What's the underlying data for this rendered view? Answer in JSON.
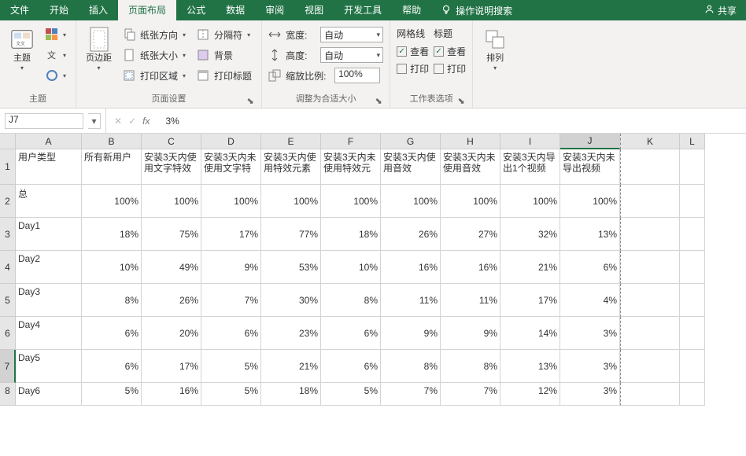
{
  "tabs": {
    "file": "文件",
    "home": "开始",
    "insert": "插入",
    "page_layout": "页面布局",
    "formulas": "公式",
    "data": "数据",
    "review": "审阅",
    "view": "视图",
    "developer": "开发工具",
    "help": "帮助",
    "tell_me": "操作说明搜索",
    "share": "共享"
  },
  "ribbon": {
    "themes": {
      "theme": "主题",
      "label": "主题"
    },
    "margins": "页边距",
    "page_setup": {
      "orientation": "纸张方向",
      "size": "纸张大小",
      "print_area": "打印区域",
      "breaks": "分隔符",
      "background": "背景",
      "print_titles": "打印标题",
      "label": "页面设置"
    },
    "scale": {
      "width": "宽度:",
      "height": "高度:",
      "scale": "缩放比例:",
      "auto": "自动",
      "zoom_value": "100%",
      "label": "调整为合适大小"
    },
    "sheet_options": {
      "gridlines": "网格线",
      "headings": "标题",
      "view": "查看",
      "print": "打印",
      "label": "工作表选项"
    },
    "arrange": {
      "arrange": "排列"
    }
  },
  "name_box": "J7",
  "formula": "3%",
  "columns": [
    "A",
    "B",
    "C",
    "D",
    "E",
    "F",
    "G",
    "H",
    "I",
    "J",
    "K",
    "L"
  ],
  "row_numbers": [
    "1",
    "2",
    "3",
    "4",
    "5",
    "6",
    "7",
    "8"
  ],
  "selected_col": "J",
  "selected_row": "7",
  "chart_data": {
    "type": "table",
    "headers": [
      "用户类型",
      "所有新用户",
      "安装3天内使用文字特效",
      "安装3天内未使用文字特",
      "安装3天内使用特效元素",
      "安装3天内未使用特效元",
      "安装3天内使用音效",
      "安装3天内未使用音效",
      "安装3天内导出1个视频",
      "安装3天内未导出视频"
    ],
    "rows": [
      {
        "label": "总",
        "values": [
          "100%",
          "100%",
          "100%",
          "100%",
          "100%",
          "100%",
          "100%",
          "100%",
          "100%"
        ]
      },
      {
        "label": "Day1",
        "values": [
          "18%",
          "75%",
          "17%",
          "77%",
          "18%",
          "26%",
          "27%",
          "32%",
          "13%"
        ]
      },
      {
        "label": "Day2",
        "values": [
          "10%",
          "49%",
          "9%",
          "53%",
          "10%",
          "16%",
          "16%",
          "21%",
          "6%"
        ]
      },
      {
        "label": "Day3",
        "values": [
          "8%",
          "26%",
          "7%",
          "30%",
          "8%",
          "11%",
          "11%",
          "17%",
          "4%"
        ]
      },
      {
        "label": "Day4",
        "values": [
          "6%",
          "20%",
          "6%",
          "23%",
          "6%",
          "9%",
          "9%",
          "14%",
          "3%"
        ]
      },
      {
        "label": "Day5",
        "values": [
          "6%",
          "17%",
          "5%",
          "21%",
          "6%",
          "8%",
          "8%",
          "13%",
          "3%"
        ]
      },
      {
        "label": "Day6",
        "values": [
          "5%",
          "16%",
          "5%",
          "18%",
          "5%",
          "7%",
          "7%",
          "12%",
          "3%"
        ]
      }
    ]
  }
}
